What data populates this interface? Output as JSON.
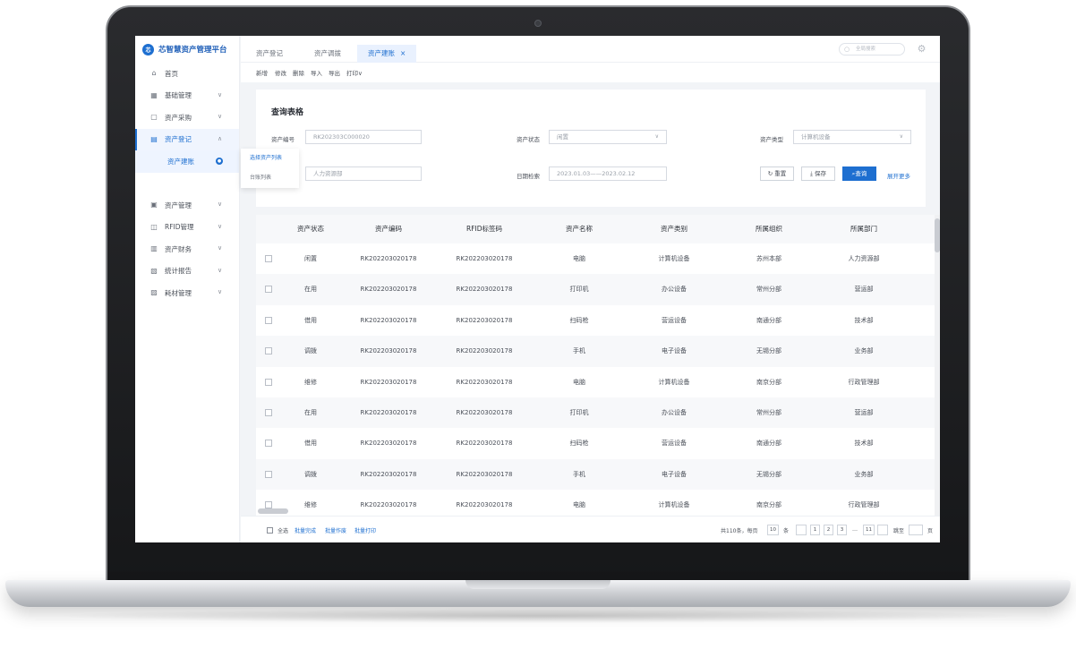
{
  "app": {
    "brand_logo": "芯",
    "brand_name": "芯智慧资产管理平台"
  },
  "sidebar": {
    "items": [
      {
        "label": "首页",
        "icon": "home-icon",
        "has_chevron": false
      },
      {
        "label": "基础管理",
        "icon": "grid-icon",
        "has_chevron": true
      },
      {
        "label": "资产采购",
        "icon": "cart-icon",
        "has_chevron": true
      },
      {
        "label": "资产登记",
        "icon": "register-icon",
        "has_chevron": true,
        "active": true
      },
      {
        "label": "资产管理",
        "icon": "asset-icon",
        "has_chevron": true
      },
      {
        "label": "RFID管理",
        "icon": "rfid-icon",
        "has_chevron": true
      },
      {
        "label": "资产财务",
        "icon": "finance-icon",
        "has_chevron": true
      },
      {
        "label": "统计报告",
        "icon": "report-icon",
        "has_chevron": true
      },
      {
        "label": "耗材管理",
        "icon": "supplies-icon",
        "has_chevron": true
      }
    ],
    "sub_item": {
      "label": "资产建账",
      "badge": "●"
    },
    "flyout": [
      "选择资产列表",
      "台账列表"
    ]
  },
  "tabs": [
    {
      "label": "资产登记"
    },
    {
      "label": "资产调拨"
    },
    {
      "label": "资产建账",
      "active": true,
      "close": "×"
    }
  ],
  "top": {
    "search_placeholder": "全局搜索"
  },
  "toolbar": [
    "新增",
    "修改",
    "删除",
    "导入",
    "导出",
    "打印∨"
  ],
  "query": {
    "title": "查询表格",
    "asset_no_label": "资产编号",
    "asset_no_value": "RK202303C000020",
    "status_label": "资产状态",
    "status_value": "闲置",
    "type_label": "资产类型",
    "type_value": "计算机设备",
    "dept_value": "人力资源部",
    "date_label": "日期检索",
    "date_value": "2023.01.03——2023.02.12",
    "reset": "重置",
    "save": "保存",
    "search": "查询",
    "more": "展开更多"
  },
  "table": {
    "columns": [
      "资产状态",
      "资产编码",
      "RFID标签码",
      "资产名称",
      "资产类别",
      "所属组织",
      "所属部门"
    ],
    "rows": [
      [
        "闲置",
        "RK202203020178",
        "RK202203020178",
        "电脑",
        "计算机设备",
        "苏州本部",
        "人力资源部"
      ],
      [
        "在用",
        "RK202203020178",
        "RK202203020178",
        "打印机",
        "办公设备",
        "常州分部",
        "营运部"
      ],
      [
        "借用",
        "RK202203020178",
        "RK202203020178",
        "扫码枪",
        "营运设备",
        "南通分部",
        "技术部"
      ],
      [
        "调拨",
        "RK202203020178",
        "RK202203020178",
        "手机",
        "电子设备",
        "无锡分部",
        "业务部"
      ],
      [
        "维修",
        "RK202203020178",
        "RK202203020178",
        "电脑",
        "计算机设备",
        "南京分部",
        "行政管理部"
      ],
      [
        "在用",
        "RK202203020178",
        "RK202203020178",
        "打印机",
        "办公设备",
        "常州分部",
        "营运部"
      ],
      [
        "借用",
        "RK202203020178",
        "RK202203020178",
        "扫码枪",
        "营运设备",
        "南通分部",
        "技术部"
      ],
      [
        "调拨",
        "RK202203020178",
        "RK202203020178",
        "手机",
        "电子设备",
        "无锡分部",
        "业务部"
      ],
      [
        "维修",
        "RK202203020178",
        "RK202203020178",
        "电脑",
        "计算机设备",
        "南京分部",
        "行政管理部"
      ]
    ]
  },
  "footer": {
    "select_all": "全选",
    "batch_done": "批量完成",
    "batch_void": "批量作废",
    "batch_print": "批量打印",
    "total": "共110条，每页",
    "page_size": "10",
    "unit": "条",
    "pages": [
      "1",
      "2",
      "3",
      "…",
      "11"
    ],
    "goto": "跳至",
    "page_unit": "页"
  },
  "colors": {
    "accent": "#1e6fd0",
    "sidebar_bg": "#ffffff",
    "content_bg": "#f2f4f7"
  }
}
